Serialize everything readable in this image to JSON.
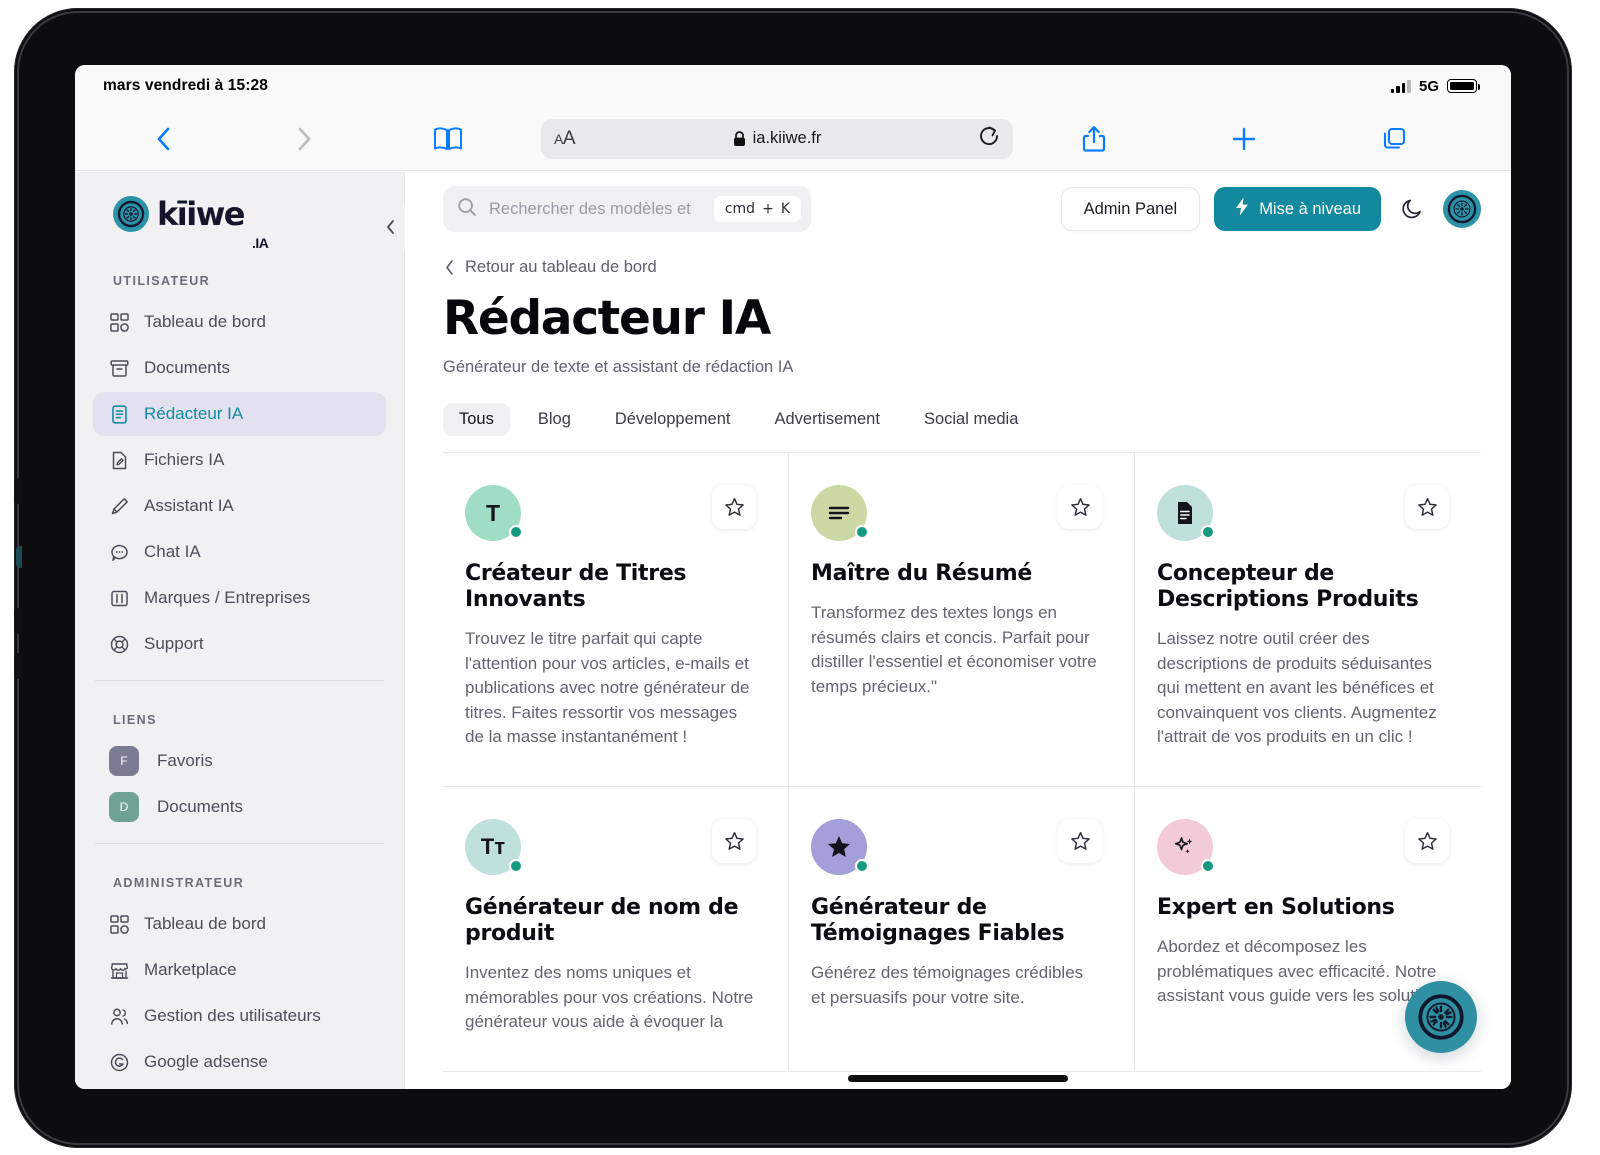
{
  "status_bar": {
    "time": "mars vendredi à 15:28",
    "network": "5G"
  },
  "browser": {
    "aa_label": "AA",
    "url": "ia.kiiwe.fr"
  },
  "sidebar": {
    "brand": {
      "name": "kīiwe",
      "suffix": ".IA"
    },
    "sections": [
      {
        "label": "UTILISATEUR",
        "items": [
          {
            "label": "Tableau de bord",
            "icon": "grid-icon",
            "active": false
          },
          {
            "label": "Documents",
            "icon": "archive-icon",
            "active": false
          },
          {
            "label": "Rédacteur IA",
            "icon": "document-text-icon",
            "active": true
          },
          {
            "label": "Fichiers IA",
            "icon": "file-edit-icon",
            "active": false
          },
          {
            "label": "Assistant IA",
            "icon": "pen-icon",
            "active": false
          },
          {
            "label": "Chat IA",
            "icon": "chat-bubble-icon",
            "active": false
          },
          {
            "label": "Marques / Entreprises",
            "icon": "columns-icon",
            "active": false
          },
          {
            "label": "Support",
            "icon": "lifebuoy-icon",
            "active": false
          }
        ]
      },
      {
        "label": "LIENS",
        "items": [
          {
            "label": "Favoris",
            "badge": "F",
            "badge_color": "#7b7b94"
          },
          {
            "label": "Documents",
            "badge": "D",
            "badge_color": "#6ea293"
          }
        ]
      },
      {
        "label": "ADMINISTRATEUR",
        "items": [
          {
            "label": "Tableau de bord",
            "icon": "grid-icon",
            "active": false
          },
          {
            "label": "Marketplace",
            "icon": "store-icon",
            "active": false
          },
          {
            "label": "Gestion des utilisateurs",
            "icon": "users-icon",
            "active": false
          },
          {
            "label": "Google adsense",
            "icon": "circle-g-icon",
            "active": false
          }
        ]
      }
    ]
  },
  "header": {
    "search_placeholder": "Rechercher des modèles et",
    "kbd_cmd": "cmd",
    "kbd_plus": "+",
    "kbd_key": "K",
    "admin_panel": "Admin Panel",
    "upgrade": "Mise à niveau"
  },
  "main": {
    "breadcrumb": "Retour au tableau de bord",
    "title": "Rédacteur IA",
    "subtitle": "Générateur de texte et assistant de rédaction IA",
    "tabs": [
      {
        "label": "Tous",
        "active": true
      },
      {
        "label": "Blog",
        "active": false
      },
      {
        "label": "Développement",
        "active": false
      },
      {
        "label": "Advertisement",
        "active": false
      },
      {
        "label": "Social media",
        "active": false
      }
    ],
    "cards": [
      {
        "title": "Créateur de Titres Innovants",
        "description": "Trouvez le titre parfait qui capte l'attention pour vos articles, e-mails et publications avec notre générateur de titres. Faites ressortir vos messages de la masse instantanément !",
        "avatar_bg": "#a0ddc5",
        "avatar_glyph": "T",
        "avatar_icon": "letter-t-icon"
      },
      {
        "title": "Maître du Résumé",
        "description": "Transformez des textes longs en résumés clairs et concis. Parfait pour distiller l'essentiel et économiser votre temps précieux.\"",
        "avatar_bg": "#ccd9a5",
        "avatar_glyph": "",
        "avatar_icon": "text-lines-icon"
      },
      {
        "title": "Concepteur de Descriptions Produits",
        "description": "Laissez notre outil créer des descriptions de produits séduisantes qui mettent en avant les bénéfices et convainquent vos clients. Augmentez l'attrait de vos produits en un clic !",
        "avatar_bg": "#bfdfdb",
        "avatar_glyph": "",
        "avatar_icon": "document-icon"
      },
      {
        "title": "Générateur de nom de produit",
        "description": "Inventez des noms uniques et mémorables pour vos créations. Notre générateur vous aide à évoquer la",
        "avatar_bg": "#c0e0dd",
        "avatar_glyph": "Tт",
        "avatar_icon": "typography-icon"
      },
      {
        "title": "Générateur de Témoignages Fiables",
        "description": "Générez des témoignages crédibles et persuasifs pour votre site.",
        "avatar_bg": "#a49fd8",
        "avatar_glyph": "",
        "avatar_icon": "star-filled-icon"
      },
      {
        "title": "Expert en Solutions",
        "description": "Abordez et décomposez les problématiques avec efficacité. Notre assistant vous guide vers les solutions",
        "avatar_bg": "#f2cbd6",
        "avatar_glyph": "",
        "avatar_icon": "sparkles-icon"
      }
    ]
  },
  "colors": {
    "accent": "#12899e",
    "brand": "#2b93a8",
    "active_nav_bg": "#e3e1ef",
    "active_nav_text": "#0f8ca0",
    "online_dot": "#159a80",
    "safari_blue": "#0a7cff"
  }
}
